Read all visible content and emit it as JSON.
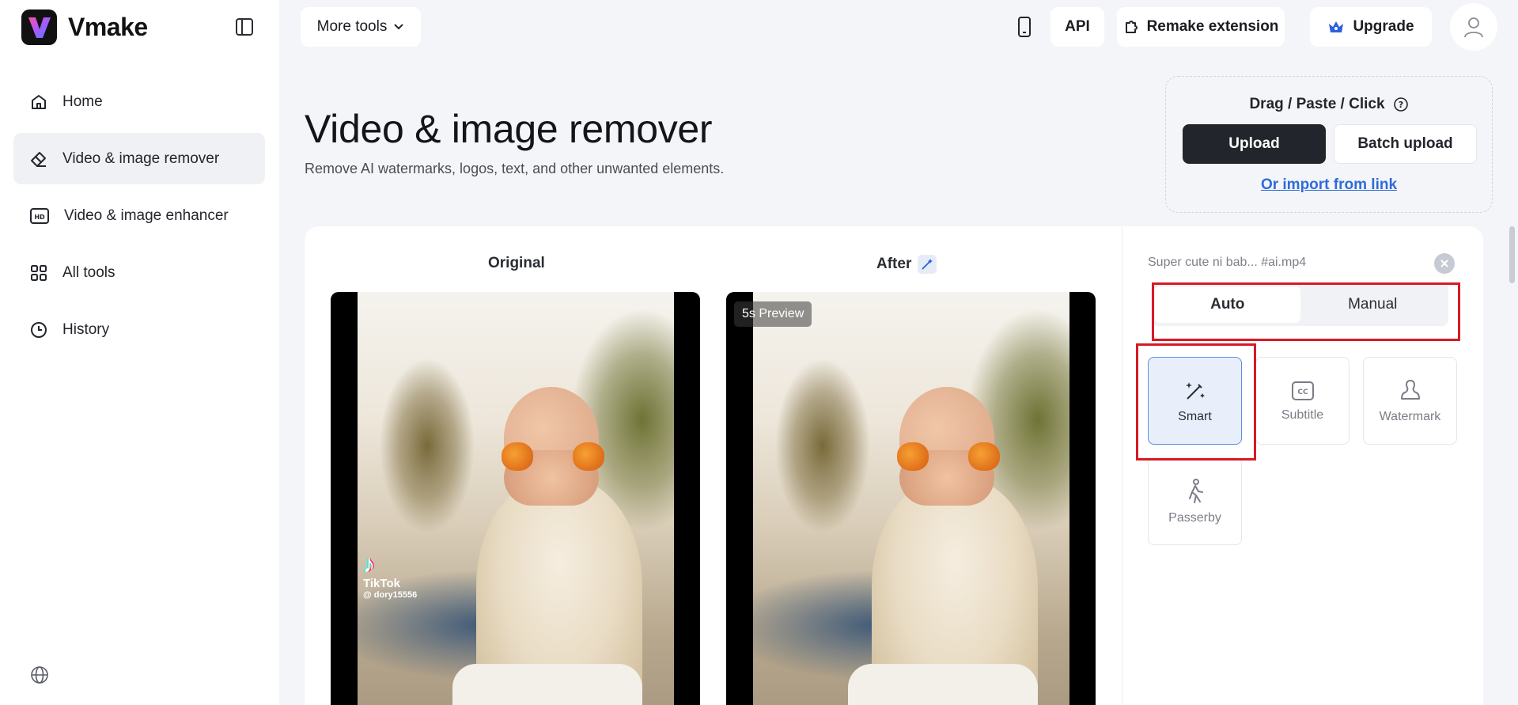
{
  "app": {
    "name": "Vmake"
  },
  "sidebar": {
    "items": [
      {
        "label": "Home",
        "icon": "home-icon",
        "active": false
      },
      {
        "label": "Video & image remover",
        "icon": "eraser-icon",
        "active": true
      },
      {
        "label": "Video & image enhancer",
        "icon": "hd-icon",
        "active": false
      },
      {
        "label": "All tools",
        "icon": "grid-icon",
        "active": false
      },
      {
        "label": "History",
        "icon": "clock-icon",
        "active": false
      }
    ]
  },
  "topbar": {
    "more_tools": "More tools",
    "api": "API",
    "remake_extension": "Remake extension",
    "upgrade": "Upgrade"
  },
  "hero": {
    "title": "Video & image remover",
    "subtitle": "Remove AI watermarks, logos, text, and other unwanted elements."
  },
  "upload": {
    "drag_label": "Drag / Paste / Click",
    "upload_label": "Upload",
    "batch_label": "Batch upload",
    "import_link": "Or import from link"
  },
  "preview": {
    "original_label": "Original",
    "after_label": "After",
    "preview_badge": "5s Preview",
    "tiktok_name": "TikTok",
    "tiktok_handle": "@ dory15556"
  },
  "panel": {
    "filename": "Super cute ni bab... #ai.mp4",
    "tabs": [
      {
        "label": "Auto",
        "active": true
      },
      {
        "label": "Manual",
        "active": false
      }
    ],
    "modes": [
      {
        "label": "Smart",
        "icon": "magic-wand-icon",
        "active": true
      },
      {
        "label": "Subtitle",
        "icon": "cc-icon",
        "active": false
      },
      {
        "label": "Watermark",
        "icon": "watermark-icon",
        "active": false
      },
      {
        "label": "Passerby",
        "icon": "walking-person-icon",
        "active": false
      }
    ]
  },
  "colors": {
    "accent": "#2f6bdb",
    "primary_button": "#22252b",
    "highlight_box": "#d71a26",
    "active_mode_bg": "#e9effa",
    "sidebar_active_bg": "#eff1f5"
  }
}
